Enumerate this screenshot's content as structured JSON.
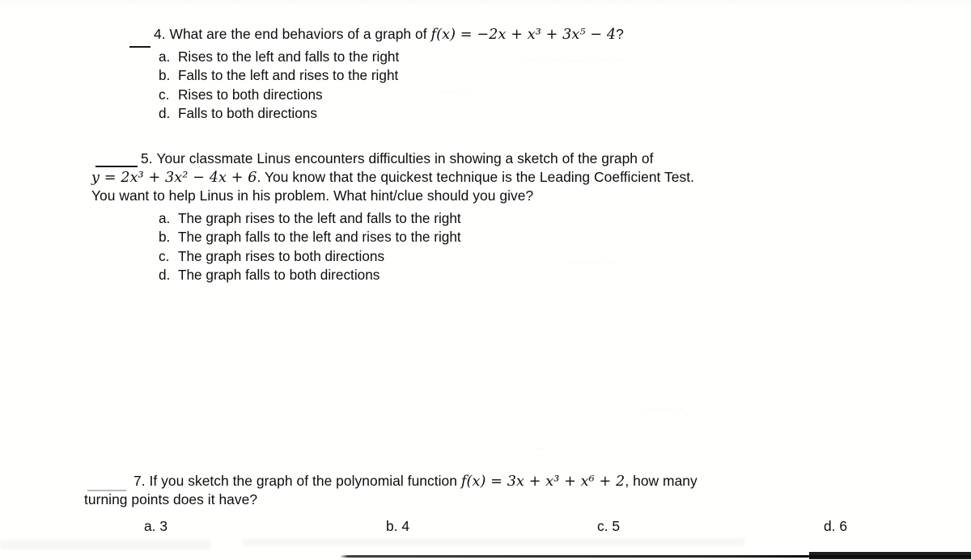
{
  "document": {
    "type": "scanned-worksheet",
    "subject": "Polynomial functions multiple-choice quiz",
    "ink_color": "#0d0d0d",
    "paper_color": "#fffffe"
  },
  "questions": [
    {
      "number": "4.",
      "stem_prefix": "What are the end behaviors of a graph of ",
      "equation": {
        "fn": "f",
        "arg": "(x)",
        "equals": "=",
        "rhs": "−2x + x³ + 3x⁵ − 4",
        "terminator": "?"
      },
      "options": [
        {
          "letter": "a.",
          "text": "Rises to the left and falls to the right"
        },
        {
          "letter": "b.",
          "text": "Falls to the left and rises to the right"
        },
        {
          "letter": "c.",
          "text": "Rises to both directions"
        },
        {
          "letter": "d.",
          "text": "Falls to both directions"
        }
      ]
    },
    {
      "number": "5.",
      "line1": "Your classmate Linus encounters difficulties in showing a sketch of the graph of",
      "equation": {
        "lhs": "y",
        "equals": "=",
        "rhs": "2x³ + 3x² − 4x + 6"
      },
      "line2_after_equation": ". You know that the quickest technique is the Leading Coefficient Test.",
      "line3": "You want to help Linus in his problem. What hint/clue should you give?",
      "options": [
        {
          "letter": "a.",
          "text": "The graph rises to the left and falls to the right"
        },
        {
          "letter": "b.",
          "text": "The graph falls to the left and rises to the right"
        },
        {
          "letter": "c.",
          "text": "The graph rises to both directions"
        },
        {
          "letter": "d.",
          "text": "The graph falls to both directions"
        }
      ]
    },
    {
      "number": "7.",
      "stem_prefix": "If you sketch the graph of the polynomial function ",
      "equation": {
        "fn": "f",
        "arg": "(x)",
        "equals": "=",
        "rhs": "3x + x³ + x⁶ + 2"
      },
      "stem_suffix": ", how many",
      "line2": "turning points does it have?",
      "options": [
        {
          "letter": "a.",
          "text": "3"
        },
        {
          "letter": "b.",
          "text": "4"
        },
        {
          "letter": "c.",
          "text": "5"
        },
        {
          "letter": "d.",
          "text": "6"
        }
      ]
    }
  ]
}
